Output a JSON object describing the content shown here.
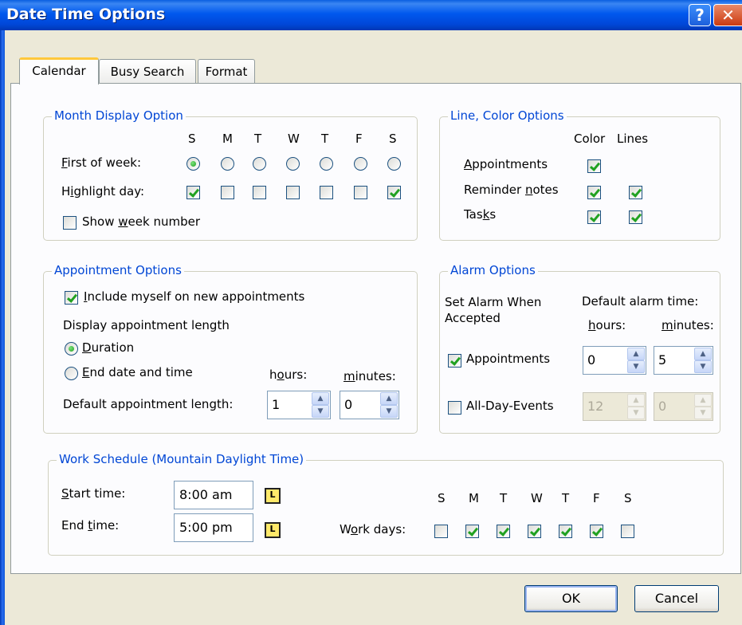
{
  "window": {
    "title": "Date Time Options"
  },
  "titlebar": {
    "help_glyph": "?",
    "close_glyph": "✕"
  },
  "tabs": [
    {
      "label": "Calendar",
      "active": true
    },
    {
      "label": "Busy Search",
      "active": false
    },
    {
      "label": "Format",
      "active": false
    }
  ],
  "month_display": {
    "legend": "Month Display Option",
    "days": [
      "S",
      "M",
      "T",
      "W",
      "T",
      "F",
      "S"
    ],
    "first_of_week_label": "First of week:",
    "first_of_week_selected": 0,
    "highlight_day_label": "Highlight day:",
    "highlight_checked": [
      true,
      false,
      false,
      false,
      false,
      false,
      true
    ],
    "show_week_number_label": "Show week number",
    "show_week_number": false
  },
  "line_color": {
    "legend": "Line, Color Options",
    "color_header": "Color",
    "lines_header": "Lines",
    "rows": [
      {
        "label": "Appointments",
        "color": true,
        "lines": null
      },
      {
        "label": "Reminder notes",
        "color": true,
        "lines": true
      },
      {
        "label": "Tasks",
        "color": true,
        "lines": true
      }
    ]
  },
  "appointment": {
    "legend": "Appointment Options",
    "include_myself_label": "Include myself on new appointments",
    "include_myself": true,
    "display_length_label": "Display appointment length",
    "duration_label": "Duration",
    "end_date_label": "End date and time",
    "selected": "duration",
    "hours_label": "hours:",
    "minutes_label": "minutes:",
    "default_length_label": "Default appointment length:",
    "hours_value": "1",
    "minutes_value": "0"
  },
  "alarm": {
    "legend": "Alarm Options",
    "set_alarm_label": "Set Alarm When Accepted",
    "default_time_label": "Default alarm time:",
    "hours_label": "hours:",
    "minutes_label": "minutes:",
    "appointments_label": "Appointments",
    "appointments_checked": true,
    "appointments_hours": "0",
    "appointments_minutes": "5",
    "all_day_label": "All-Day-Events",
    "all_day_checked": false,
    "all_day_hours": "12",
    "all_day_minutes": "0"
  },
  "work_schedule": {
    "legend": "Work Schedule (Mountain Daylight Time)",
    "start_label": "Start time:",
    "start_value": "8:00 am",
    "end_label": "End time:",
    "end_value": "5:00 pm",
    "clock_glyph": "L",
    "work_days_label": "Work days:",
    "days": [
      "S",
      "M",
      "T",
      "W",
      "T",
      "F",
      "S"
    ],
    "work_days_checked": [
      false,
      true,
      true,
      true,
      true,
      true,
      false
    ]
  },
  "buttons": {
    "ok": "OK",
    "cancel": "Cancel"
  },
  "colors": {
    "titlebar": "#0054e3",
    "legend": "#0046d5",
    "face": "#ece9d8",
    "check": "#21a121"
  }
}
